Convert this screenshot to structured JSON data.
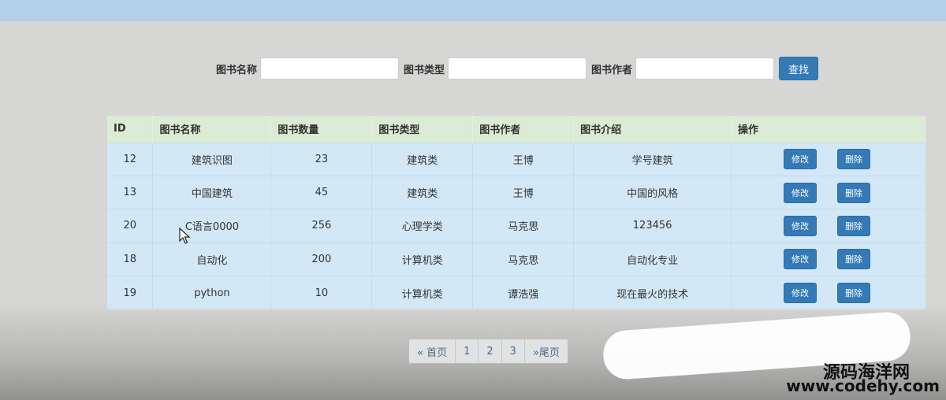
{
  "search": {
    "name_label": "图书名称",
    "type_label": "图书类型",
    "author_label": "图书作者",
    "name_value": "",
    "type_value": "",
    "author_value": "",
    "search_button": "查找"
  },
  "table": {
    "headers": [
      "ID",
      "图书名称",
      "图书数量",
      "图书类型",
      "图书作者",
      "图书介绍",
      "操作"
    ],
    "rows": [
      {
        "id": "12",
        "name": "建筑识图",
        "count": "23",
        "type": "建筑类",
        "author": "王博",
        "intro": "学号建筑",
        "edit": "修改",
        "delete": "删除"
      },
      {
        "id": "13",
        "name": "中国建筑",
        "count": "45",
        "type": "建筑类",
        "author": "王博",
        "intro": "中国的风格",
        "edit": "修改",
        "delete": "删除"
      },
      {
        "id": "20",
        "name": "C语言0000",
        "count": "256",
        "type": "心理学类",
        "author": "马克思",
        "intro": "123456",
        "edit": "修改",
        "delete": "删除"
      },
      {
        "id": "18",
        "name": "自动化",
        "count": "200",
        "type": "计算机类",
        "author": "马克思",
        "intro": "自动化专业",
        "edit": "修改",
        "delete": "删除"
      },
      {
        "id": "19",
        "name": "python",
        "count": "10",
        "type": "计算机类",
        "author": "谭浩强",
        "intro": "现在最火的技术",
        "edit": "修改",
        "delete": "删除"
      }
    ]
  },
  "pagination": {
    "first": "« 首页",
    "pages": [
      "1",
      "2",
      "3"
    ],
    "last": "»尾页"
  },
  "watermark": {
    "line1": "源码海洋网",
    "line2": "www.codehy.com"
  },
  "colors": {
    "topbar": "#b3d1e8",
    "accent": "#337ab7",
    "header_row": "#dcebd4",
    "body_row": "#d3e8f6"
  }
}
